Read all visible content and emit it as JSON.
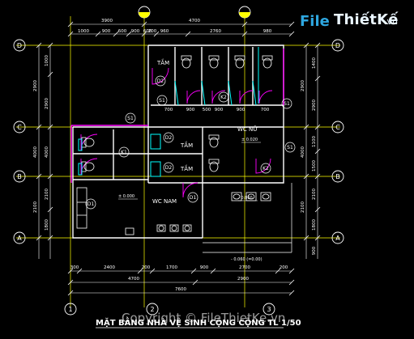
{
  "drawing": {
    "title": "MẶT BẰNG NHÀ VỆ SINH CỘNG CỘNG TL 1/50",
    "watermark": "Copyright © FileThietKe.vn",
    "logo_word": "File",
    "logo_rest": "ThiếtKế",
    "logo_suffix": ".vn",
    "colors": {
      "background": "#000000",
      "wall": "#ffffff",
      "dim": "#ffffff",
      "grid": "#ffff00",
      "door": "#ff00ff",
      "fixture": "#00ffff",
      "room_label": "#ffffff",
      "accent": "#2ea7e0"
    }
  },
  "grid_marks": {
    "columns": [
      "1",
      "2",
      "3"
    ],
    "rows": [
      "D",
      "C",
      "B",
      "A"
    ]
  },
  "dimensions": {
    "top_overall": [
      "3900",
      "4700"
    ],
    "top_parts": [
      "1000",
      "900",
      "600",
      "900",
      "600",
      "200",
      "960",
      "2760",
      "980"
    ],
    "bottom_parts": [
      "300",
      "2400",
      "200",
      "1700",
      "900",
      "2700",
      "200"
    ],
    "bottom_overall_1": "4700",
    "bottom_overall_2": "2900",
    "bottom_total": "7600",
    "left_parts": [
      "1000",
      "2900",
      "4000",
      "2100",
      "1800"
    ],
    "right_parts": [
      "1400",
      "2900",
      "4000",
      "1100",
      "2100",
      "1800",
      "900",
      "1500"
    ],
    "inner_top": [
      "700",
      "900",
      "500",
      "900",
      "900",
      "700"
    ]
  },
  "rooms": [
    {
      "id": "tam-top",
      "label": "TẮM"
    },
    {
      "id": "tam-mid-1",
      "label": "TẮM"
    },
    {
      "id": "tam-mid-2",
      "label": "TẮM"
    },
    {
      "id": "wc-nu",
      "label": "WC NỮ"
    },
    {
      "id": "wc-nam",
      "label": "WC NAM"
    }
  ],
  "tags": [
    "D2",
    "S1",
    "K2",
    "S1",
    "S1",
    "D2",
    "D2",
    "K1",
    "S1",
    "K2",
    "D1",
    "D1",
    "S1"
  ],
  "levels": [
    "± 0.020",
    "± 0.000",
    "- 0.060",
    "- 0.060 (=0.00)"
  ]
}
